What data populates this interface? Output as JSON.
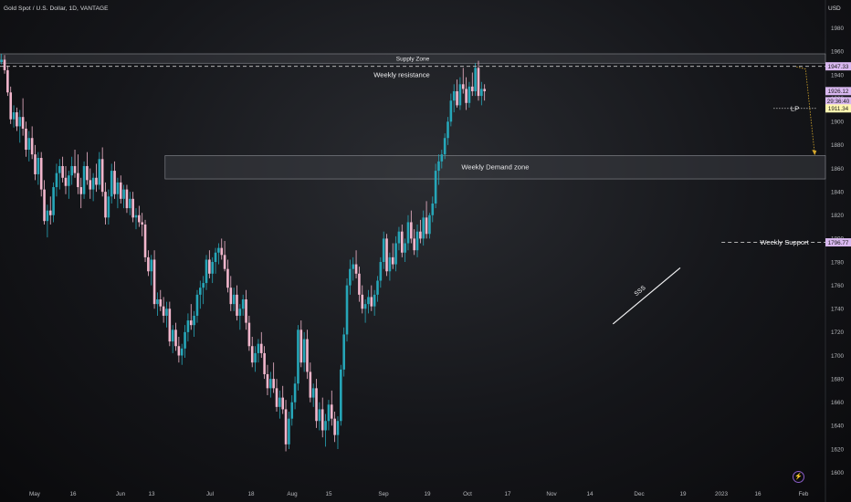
{
  "header": {
    "title": "Gold Spot / U.S. Dollar, 1D, VANTAGE",
    "currency": "USD"
  },
  "colors": {
    "up": "#26a6b8",
    "down": "#f2b6cc",
    "dashed": "#c8c8c8",
    "zone_fill": "#3a3c42",
    "label_purple": "#d9b8f0",
    "label_yellow": "#fff7b0",
    "projection": "#d4a72c"
  },
  "icons": {
    "tv_logo": "tradingview-logo-icon"
  },
  "chart_data": {
    "type": "candlestick",
    "y_axis": {
      "ticks": [
        1600,
        1620,
        1640,
        1660,
        1680,
        1700,
        1720,
        1740,
        1760,
        1780,
        1800,
        1820,
        1840,
        1860,
        1880,
        1900,
        1920,
        1940,
        1960,
        1980
      ],
      "ylim": [
        1595,
        1990
      ]
    },
    "x_axis": {
      "labels": [
        "May",
        "16",
        "Jun",
        "13",
        "Jul",
        "18",
        "Aug",
        "15",
        "Sep",
        "19",
        "Oct",
        "17",
        "Nov",
        "14",
        "Dec",
        "19",
        "2023",
        "16",
        "Feb"
      ]
    },
    "price_labels": [
      {
        "text": "1947.33",
        "value": 1947.33,
        "style": "purple"
      },
      {
        "text": "1926.12",
        "value": 1926.12,
        "style": "purple"
      },
      {
        "text": "29:36:40",
        "value": 1917.5,
        "style": "purple"
      },
      {
        "text": "1911.34",
        "value": 1911.34,
        "style": "yellow"
      },
      {
        "text": "1796.77",
        "value": 1796.77,
        "style": "purple"
      }
    ],
    "zones": [
      {
        "label": "Supply Zone",
        "top": 1958,
        "bottom": 1950,
        "x_start": 0,
        "x_end": 269
      },
      {
        "label": "Weekly Demand zone",
        "top": 1871,
        "bottom": 1851,
        "x_start": 54,
        "x_end": 269
      }
    ],
    "levels": [
      {
        "label": "Weekly resistance",
        "value": 1947.33,
        "x_start": 0,
        "x_end": 269
      },
      {
        "label": "Weekly Support",
        "value": 1796.77,
        "x_start": 236,
        "x_end": 269
      },
      {
        "label": "LP",
        "value": 1911.34,
        "x_start": 253,
        "x_end": 266
      }
    ],
    "trendline": {
      "label": "SSS",
      "start": {
        "x": 200,
        "y": 1727
      },
      "end": {
        "x": 222,
        "y": 1775
      }
    },
    "projection": {
      "points": [
        [
          260,
          1947
        ],
        [
          263,
          1945
        ],
        [
          266,
          1872
        ]
      ]
    },
    "candles": [
      [
        1951,
        1958,
        1949,
        1953
      ],
      [
        1953,
        1957,
        1941,
        1944
      ],
      [
        1944,
        1948,
        1922,
        1925
      ],
      [
        1925,
        1930,
        1898,
        1902
      ],
      [
        1902,
        1914,
        1895,
        1908
      ],
      [
        1908,
        1912,
        1892,
        1896
      ],
      [
        1896,
        1910,
        1882,
        1904
      ],
      [
        1904,
        1920,
        1888,
        1894
      ],
      [
        1894,
        1900,
        1870,
        1876
      ],
      [
        1876,
        1892,
        1866,
        1886
      ],
      [
        1886,
        1896,
        1868,
        1872
      ],
      [
        1872,
        1880,
        1850,
        1855
      ],
      [
        1855,
        1874,
        1846,
        1869
      ],
      [
        1869,
        1874,
        1836,
        1842
      ],
      [
        1842,
        1850,
        1812,
        1815
      ],
      [
        1815,
        1829,
        1801,
        1824
      ],
      [
        1824,
        1836,
        1812,
        1820
      ],
      [
        1820,
        1848,
        1814,
        1844
      ],
      [
        1844,
        1864,
        1836,
        1856
      ],
      [
        1856,
        1868,
        1842,
        1862
      ],
      [
        1862,
        1870,
        1848,
        1852
      ],
      [
        1852,
        1862,
        1838,
        1845
      ],
      [
        1845,
        1858,
        1834,
        1854
      ],
      [
        1854,
        1870,
        1846,
        1862
      ],
      [
        1862,
        1876,
        1852,
        1856
      ],
      [
        1856,
        1872,
        1838,
        1844
      ],
      [
        1844,
        1852,
        1826,
        1838
      ],
      [
        1838,
        1866,
        1834,
        1862
      ],
      [
        1862,
        1874,
        1846,
        1850
      ],
      [
        1850,
        1860,
        1834,
        1842
      ],
      [
        1842,
        1856,
        1832,
        1852
      ],
      [
        1852,
        1864,
        1840,
        1846
      ],
      [
        1846,
        1874,
        1842,
        1868
      ],
      [
        1868,
        1878,
        1836,
        1840
      ],
      [
        1840,
        1848,
        1812,
        1818
      ],
      [
        1818,
        1842,
        1812,
        1836
      ],
      [
        1836,
        1864,
        1830,
        1858
      ],
      [
        1858,
        1866,
        1834,
        1838
      ],
      [
        1838,
        1852,
        1826,
        1848
      ],
      [
        1848,
        1854,
        1830,
        1834
      ],
      [
        1834,
        1846,
        1826,
        1842
      ],
      [
        1842,
        1846,
        1822,
        1826
      ],
      [
        1826,
        1840,
        1820,
        1834
      ],
      [
        1834,
        1840,
        1814,
        1818
      ],
      [
        1818,
        1826,
        1808,
        1820
      ],
      [
        1820,
        1828,
        1810,
        1814
      ],
      [
        1814,
        1822,
        1802,
        1812
      ],
      [
        1812,
        1816,
        1780,
        1784
      ],
      [
        1784,
        1790,
        1768,
        1772
      ],
      [
        1772,
        1786,
        1760,
        1782
      ],
      [
        1782,
        1790,
        1740,
        1744
      ],
      [
        1744,
        1754,
        1734,
        1748
      ],
      [
        1748,
        1756,
        1738,
        1742
      ],
      [
        1742,
        1750,
        1728,
        1734
      ],
      [
        1734,
        1746,
        1724,
        1740
      ],
      [
        1740,
        1746,
        1708,
        1712
      ],
      [
        1712,
        1726,
        1702,
        1722
      ],
      [
        1722,
        1728,
        1704,
        1708
      ],
      [
        1708,
        1716,
        1694,
        1700
      ],
      [
        1700,
        1710,
        1692,
        1706
      ],
      [
        1706,
        1726,
        1698,
        1720
      ],
      [
        1720,
        1736,
        1712,
        1730
      ],
      [
        1730,
        1744,
        1722,
        1726
      ],
      [
        1726,
        1738,
        1716,
        1734
      ],
      [
        1734,
        1756,
        1728,
        1752
      ],
      [
        1752,
        1764,
        1740,
        1758
      ],
      [
        1758,
        1768,
        1744,
        1762
      ],
      [
        1762,
        1786,
        1756,
        1782
      ],
      [
        1782,
        1790,
        1766,
        1770
      ],
      [
        1770,
        1784,
        1762,
        1780
      ],
      [
        1780,
        1792,
        1770,
        1788
      ],
      [
        1788,
        1796,
        1778,
        1792
      ],
      [
        1792,
        1800,
        1782,
        1786
      ],
      [
        1786,
        1798,
        1772,
        1774
      ],
      [
        1774,
        1782,
        1754,
        1758
      ],
      [
        1758,
        1768,
        1738,
        1744
      ],
      [
        1744,
        1758,
        1738,
        1752
      ],
      [
        1752,
        1760,
        1730,
        1734
      ],
      [
        1734,
        1744,
        1722,
        1740
      ],
      [
        1740,
        1752,
        1734,
        1748
      ],
      [
        1748,
        1756,
        1722,
        1728
      ],
      [
        1728,
        1734,
        1704,
        1708
      ],
      [
        1708,
        1716,
        1690,
        1694
      ],
      [
        1694,
        1708,
        1686,
        1702
      ],
      [
        1702,
        1714,
        1694,
        1710
      ],
      [
        1710,
        1720,
        1698,
        1702
      ],
      [
        1702,
        1708,
        1680,
        1684
      ],
      [
        1684,
        1692,
        1666,
        1672
      ],
      [
        1672,
        1686,
        1664,
        1680
      ],
      [
        1680,
        1694,
        1668,
        1672
      ],
      [
        1672,
        1680,
        1652,
        1656
      ],
      [
        1656,
        1670,
        1646,
        1664
      ],
      [
        1664,
        1674,
        1650,
        1654
      ],
      [
        1654,
        1662,
        1618,
        1624
      ],
      [
        1624,
        1652,
        1620,
        1646
      ],
      [
        1646,
        1666,
        1640,
        1660
      ],
      [
        1660,
        1682,
        1654,
        1676
      ],
      [
        1676,
        1726,
        1670,
        1722
      ],
      [
        1722,
        1730,
        1690,
        1694
      ],
      [
        1694,
        1720,
        1686,
        1714
      ],
      [
        1714,
        1722,
        1680,
        1686
      ],
      [
        1686,
        1694,
        1660,
        1664
      ],
      [
        1664,
        1676,
        1656,
        1672
      ],
      [
        1672,
        1680,
        1638,
        1644
      ],
      [
        1644,
        1660,
        1636,
        1654
      ],
      [
        1654,
        1664,
        1630,
        1636
      ],
      [
        1636,
        1650,
        1622,
        1644
      ],
      [
        1644,
        1662,
        1636,
        1658
      ],
      [
        1658,
        1670,
        1640,
        1646
      ],
      [
        1646,
        1652,
        1626,
        1632
      ],
      [
        1632,
        1648,
        1620,
        1644
      ],
      [
        1644,
        1692,
        1640,
        1688
      ],
      [
        1688,
        1724,
        1682,
        1718
      ],
      [
        1718,
        1766,
        1712,
        1760
      ],
      [
        1760,
        1782,
        1752,
        1774
      ],
      [
        1774,
        1784,
        1764,
        1778
      ],
      [
        1778,
        1790,
        1766,
        1770
      ],
      [
        1770,
        1776,
        1746,
        1752
      ],
      [
        1752,
        1760,
        1736,
        1740
      ],
      [
        1740,
        1748,
        1728,
        1744
      ],
      [
        1744,
        1756,
        1736,
        1750
      ],
      [
        1750,
        1760,
        1738,
        1742
      ],
      [
        1742,
        1756,
        1734,
        1752
      ],
      [
        1752,
        1768,
        1746,
        1764
      ],
      [
        1764,
        1784,
        1758,
        1780
      ],
      [
        1780,
        1806,
        1774,
        1800
      ],
      [
        1800,
        1804,
        1768,
        1772
      ],
      [
        1772,
        1788,
        1764,
        1784
      ],
      [
        1784,
        1796,
        1774,
        1778
      ],
      [
        1778,
        1802,
        1772,
        1796
      ],
      [
        1796,
        1810,
        1790,
        1806
      ],
      [
        1806,
        1812,
        1784,
        1788
      ],
      [
        1788,
        1800,
        1780,
        1796
      ],
      [
        1796,
        1820,
        1790,
        1814
      ],
      [
        1814,
        1824,
        1796,
        1800
      ],
      [
        1800,
        1808,
        1786,
        1790
      ],
      [
        1790,
        1812,
        1784,
        1806
      ],
      [
        1806,
        1816,
        1796,
        1800
      ],
      [
        1800,
        1824,
        1794,
        1818
      ],
      [
        1818,
        1832,
        1800,
        1804
      ],
      [
        1804,
        1822,
        1800,
        1820
      ],
      [
        1820,
        1836,
        1814,
        1830
      ],
      [
        1830,
        1864,
        1826,
        1858
      ],
      [
        1858,
        1872,
        1846,
        1866
      ],
      [
        1866,
        1876,
        1860,
        1872
      ],
      [
        1872,
        1890,
        1868,
        1886
      ],
      [
        1886,
        1904,
        1880,
        1900
      ],
      [
        1900,
        1924,
        1896,
        1918
      ],
      [
        1918,
        1932,
        1908,
        1926
      ],
      [
        1926,
        1936,
        1912,
        1914
      ],
      [
        1914,
        1938,
        1910,
        1932
      ],
      [
        1932,
        1946,
        1924,
        1928
      ],
      [
        1928,
        1938,
        1910,
        1916
      ],
      [
        1916,
        1934,
        1912,
        1930
      ],
      [
        1930,
        1942,
        1922,
        1926
      ],
      [
        1926,
        1950,
        1922,
        1946
      ],
      [
        1946,
        1952,
        1918,
        1922
      ],
      [
        1922,
        1934,
        1914,
        1928
      ],
      [
        1928,
        1932,
        1918,
        1926
      ]
    ]
  }
}
